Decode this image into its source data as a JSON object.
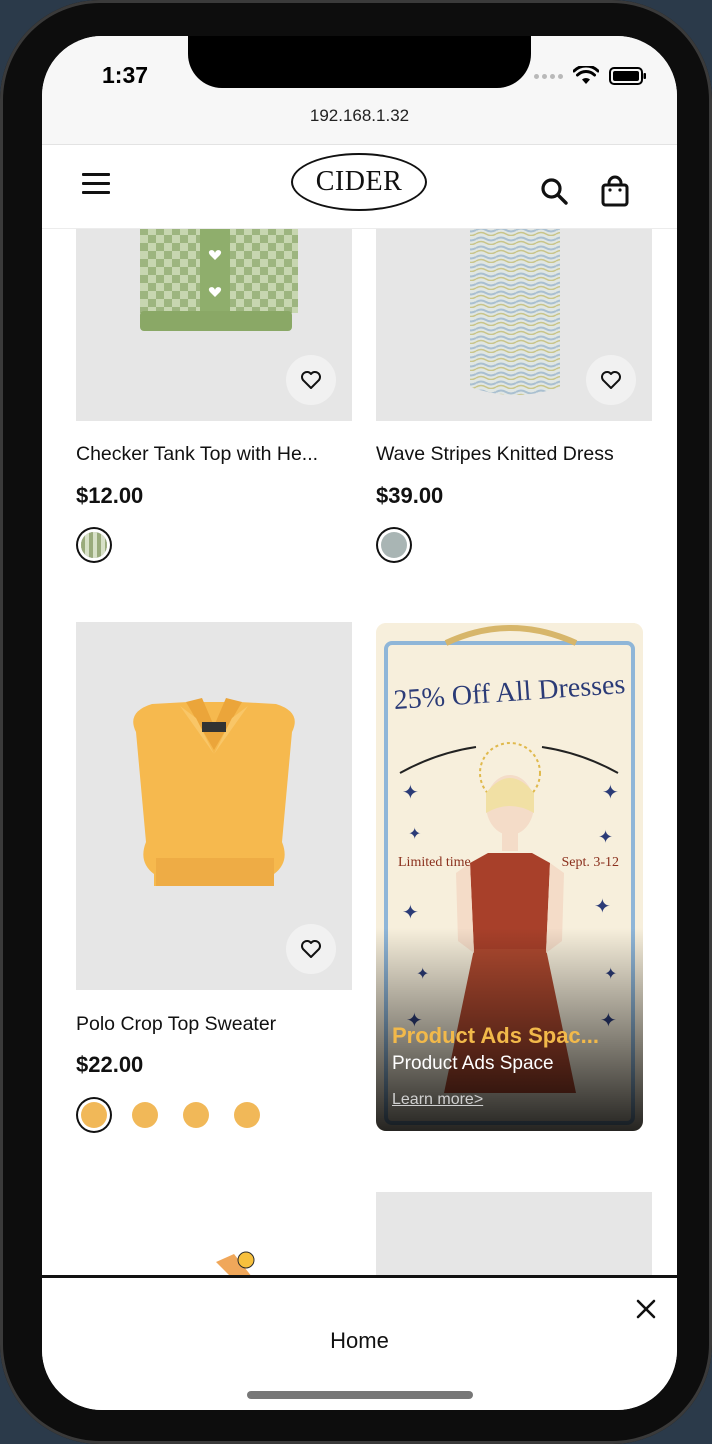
{
  "status_bar": {
    "time": "1:37"
  },
  "browser": {
    "url": "192.168.1.32"
  },
  "header": {
    "logo_text": "CIDER"
  },
  "products": [
    {
      "title": "Checker Tank Top with He...",
      "price": "$12.00",
      "swatches": [
        "#9aab7c"
      ]
    },
    {
      "title": "Wave Stripes Knitted Dress",
      "price": "$39.00",
      "swatches": [
        "#a9b5b4"
      ]
    },
    {
      "title": "Polo Crop Top Sweater",
      "price": "$22.00",
      "swatches": [
        "#f1b858",
        "#f1b858",
        "#f1b858",
        "#f1b858"
      ]
    }
  ],
  "ad": {
    "banner_text": "25% Off All Dresses",
    "left_text": "Limited time",
    "right_text": "Sept. 3-12",
    "title": "Product Ads Spac...",
    "subtitle": "Product Ads Space",
    "link": "Learn more>"
  },
  "bottom_bar": {
    "label": "Home"
  },
  "colors": {
    "card_bg": "#e6e6e6",
    "ad_title": "#f2b94a",
    "accent": "#111111"
  }
}
